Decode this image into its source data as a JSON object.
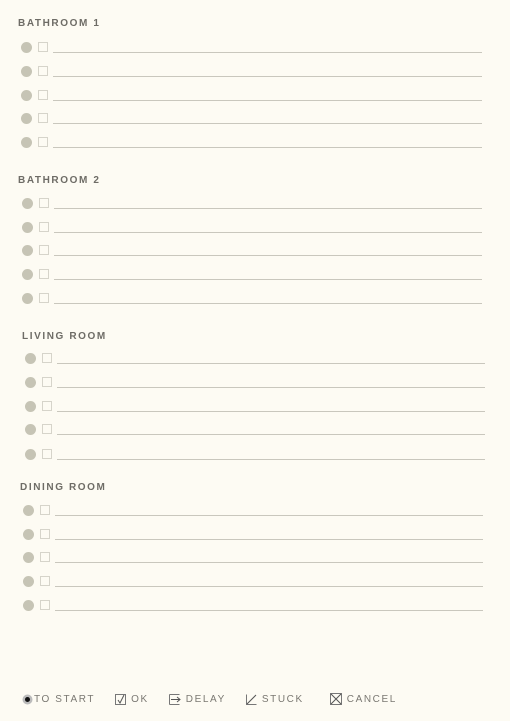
{
  "sections": [
    {
      "title": "BATHROOM 1",
      "rows": 5
    },
    {
      "title": "BATHROOM 2",
      "rows": 5
    },
    {
      "title": "LIVING ROOM",
      "rows": 5
    },
    {
      "title": "DINING ROOM",
      "rows": 5
    }
  ],
  "legend": [
    {
      "icon": "filled-circle-icon",
      "label": "TO START"
    },
    {
      "icon": "check-box-icon",
      "label": "OK"
    },
    {
      "icon": "arrow-box-icon",
      "label": "DELAY"
    },
    {
      "icon": "slash-box-icon",
      "label": "STUCK"
    },
    {
      "icon": "x-box-icon",
      "label": "CANCEL"
    }
  ],
  "colors": {
    "background": "#fdfbf3",
    "dot": "#c6c4b5",
    "text": "#6e6c66"
  }
}
